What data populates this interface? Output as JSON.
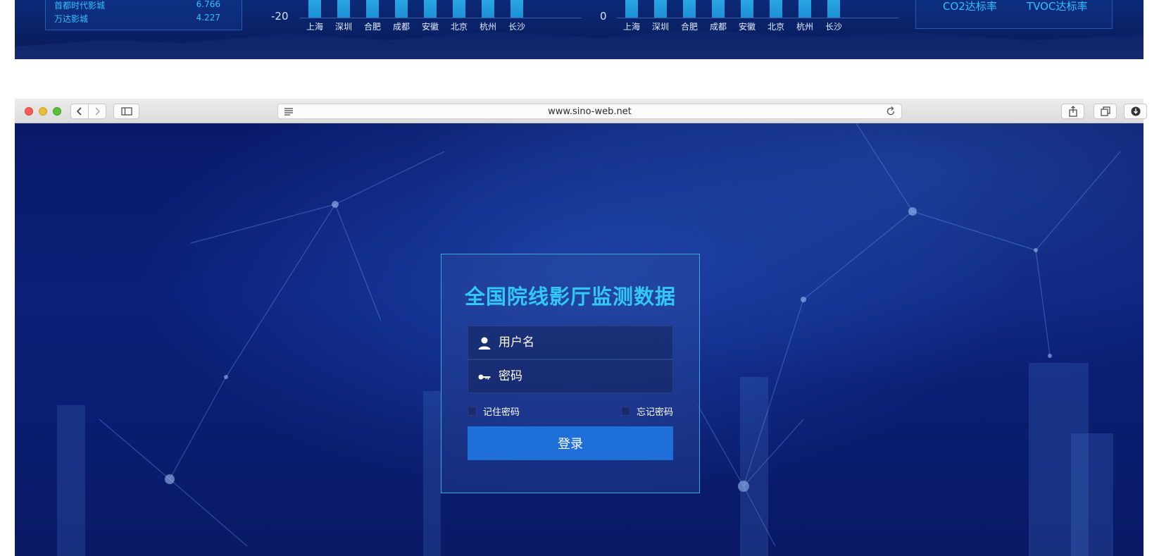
{
  "dashboard": {
    "ranking": [
      {
        "name": "首都时代影城",
        "value": "6.766"
      },
      {
        "name": "万达影城",
        "value": "4.227"
      }
    ],
    "chart_data": [
      {
        "type": "bar",
        "categories": [
          "上海",
          "深圳",
          "合肥",
          "成都",
          "安徽",
          "北京",
          "杭州",
          "长沙"
        ],
        "values": [
          null,
          null,
          null,
          null,
          null,
          null,
          null,
          null
        ],
        "ytick_visible": "-20",
        "color": "#2aa6e4"
      },
      {
        "type": "bar",
        "categories": [
          "上海",
          "深圳",
          "合肥",
          "成都",
          "安徽",
          "北京",
          "杭州",
          "长沙"
        ],
        "values": [
          null,
          null,
          null,
          null,
          null,
          null,
          null,
          null
        ],
        "ytick_visible": "0",
        "color": "#2aa6e4"
      }
    ],
    "standard_rates": [
      "CO2达标率",
      "TVOC达标率"
    ]
  },
  "browser": {
    "url": "www.sino-web.net",
    "colors": {
      "close": "#fc5b57",
      "minimize": "#e5bf3c",
      "zoom": "#57c038"
    }
  },
  "login": {
    "title": "全国院线影厅监测数据",
    "username_placeholder": "用户名",
    "password_placeholder": "密码",
    "remember_label": "记住密码",
    "forgot_label": "忘记密码",
    "submit_label": "登录",
    "colors": {
      "title": "#33c7f3",
      "button": "#1e6fd8",
      "border": "#3ca8d6"
    }
  }
}
